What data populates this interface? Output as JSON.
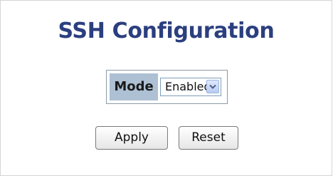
{
  "page": {
    "title": "SSH Configuration"
  },
  "form": {
    "mode_label": "Mode",
    "mode_value": "Enabled"
  },
  "buttons": {
    "apply": "Apply",
    "reset": "Reset"
  },
  "colors": {
    "title": "#2b3f7f",
    "label_background": "#adc0d4"
  },
  "icons": {
    "dropdown": "chevron-down-icon"
  }
}
